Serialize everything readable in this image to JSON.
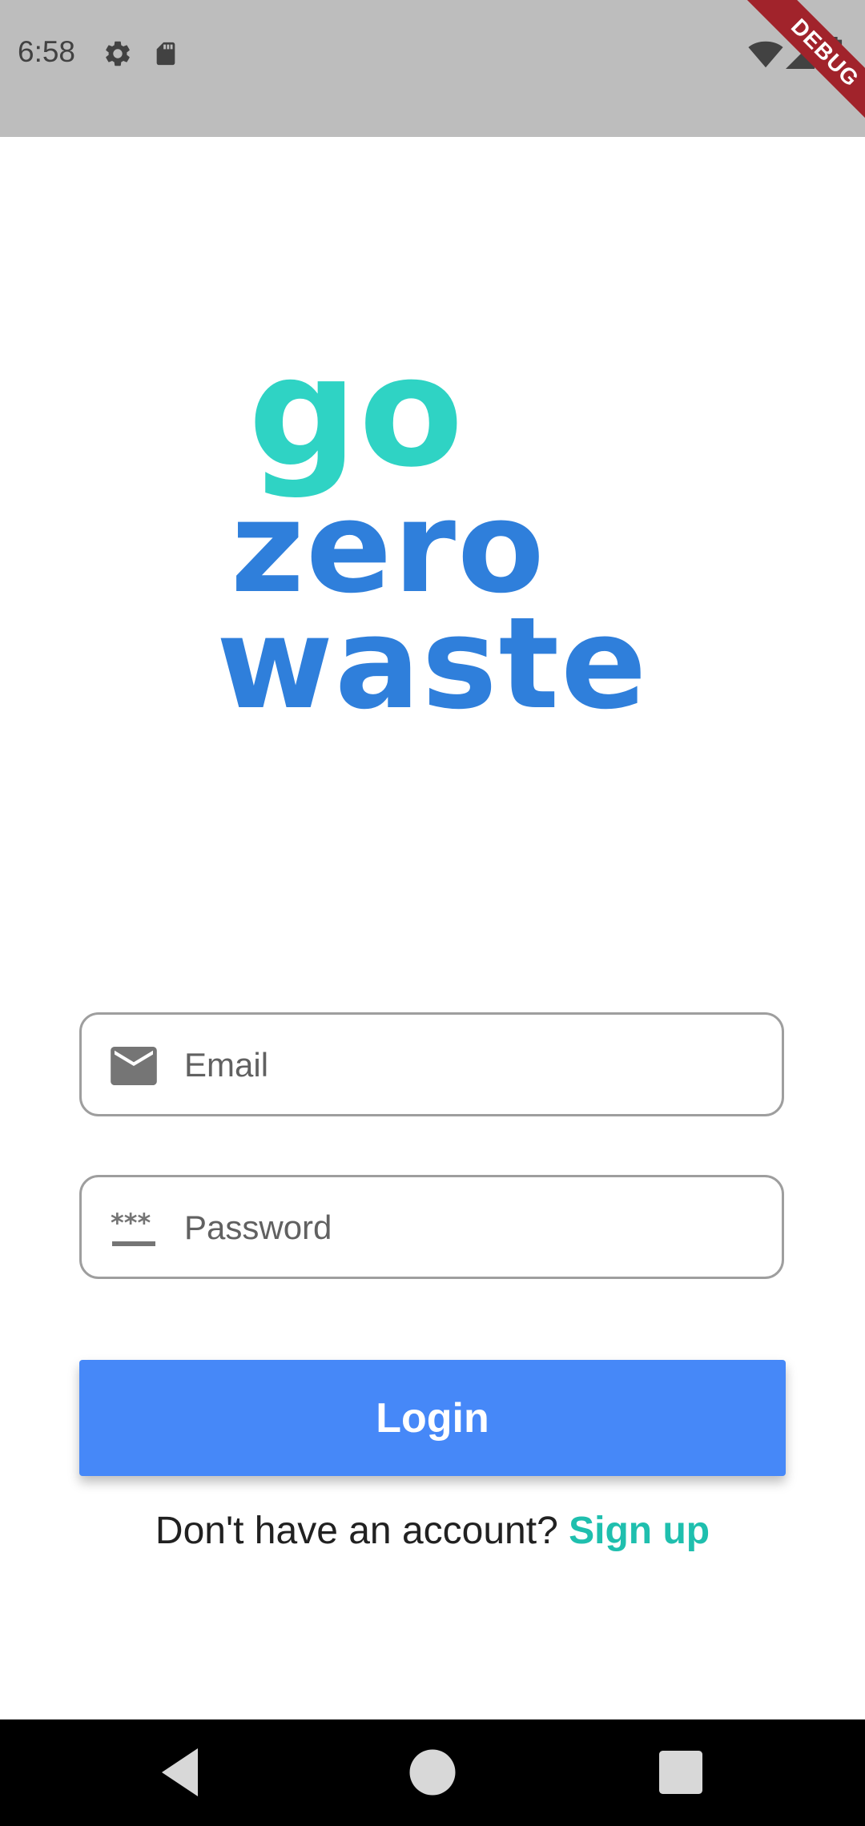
{
  "status_bar": {
    "time": "6:58",
    "icons": [
      "gear-icon",
      "sd-card-icon",
      "wifi-icon",
      "signal-icon",
      "battery-icon"
    ],
    "debug_label": "DEBUG"
  },
  "logo": {
    "line1": "go",
    "line2": "zero",
    "line3": "waste",
    "colors": {
      "go": "#2fd3c4",
      "zero_waste": "#2f7fdb"
    }
  },
  "form": {
    "email": {
      "placeholder": "Email",
      "value": "",
      "icon": "email-icon"
    },
    "password": {
      "placeholder": "Password",
      "value": "",
      "icon": "password-icon"
    },
    "login_label": "Login",
    "login_color": "#4688f8"
  },
  "signup": {
    "prompt": "Don't have an account?",
    "link_label": "Sign up",
    "link_color": "#1fbfae"
  },
  "nav_bar": {
    "buttons": [
      "back-icon",
      "home-icon",
      "recents-icon"
    ]
  }
}
